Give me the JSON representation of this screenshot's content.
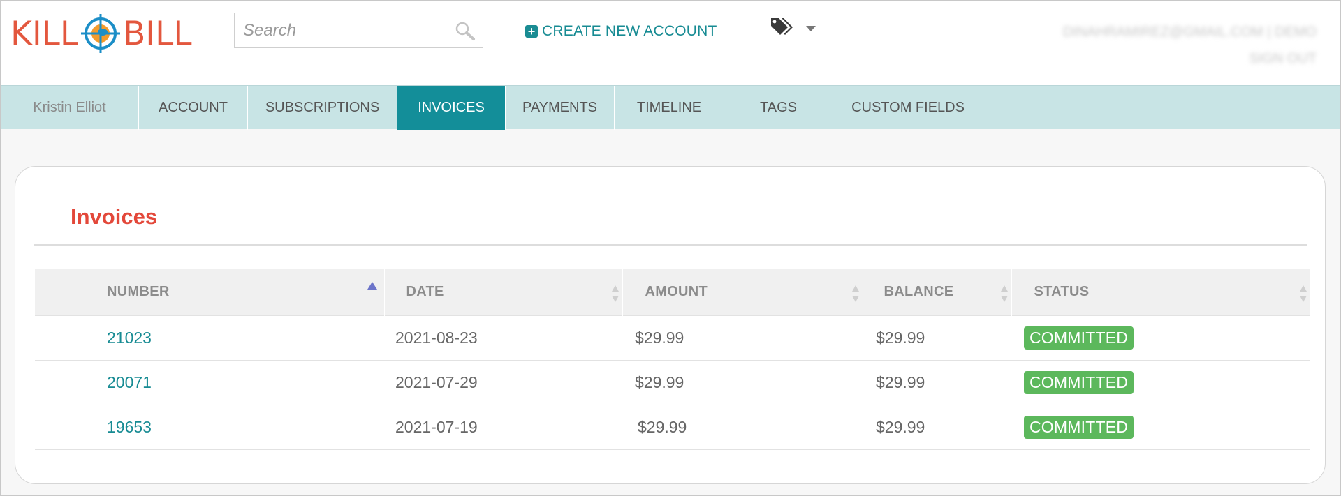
{
  "header": {
    "logo": {
      "left": "KILL",
      "right": "BILL"
    },
    "search": {
      "placeholder": "Search"
    },
    "create_account_label": "CREATE NEW ACCOUNT",
    "user_line1": "DINAHRAMIREZ@GMAIL.COM | DEMO",
    "user_line2": "SIGN OUT"
  },
  "nav": {
    "customer": "Kristin Elliot",
    "tabs": [
      {
        "label": "ACCOUNT"
      },
      {
        "label": "SUBSCRIPTIONS"
      },
      {
        "label": "INVOICES"
      },
      {
        "label": "PAYMENTS"
      },
      {
        "label": "TIMELINE"
      },
      {
        "label": "TAGS"
      },
      {
        "label": "CUSTOM FIELDS"
      }
    ]
  },
  "panel": {
    "title": "Invoices",
    "columns": [
      "NUMBER",
      "DATE",
      "AMOUNT",
      "BALANCE",
      "STATUS"
    ],
    "rows": [
      {
        "number": "21023",
        "date": "2021-08-23",
        "amount": "$29.99",
        "balance": "$29.99",
        "status": "COMMITTED"
      },
      {
        "number": "20071",
        "date": "2021-07-29",
        "amount": "$29.99",
        "balance": "$29.99",
        "status": "COMMITTED"
      },
      {
        "number": "19653",
        "date": "2021-07-19",
        "amount": "$29.99",
        "balance": "$29.99",
        "status": "COMMITTED"
      }
    ]
  },
  "colors": {
    "accent": "#138e99",
    "nav_bg": "#c8e4e5",
    "title_red": "#e3483a",
    "status_green": "#5cb85c"
  },
  "icons": {
    "search": "search-icon",
    "plus": "plus-square-icon",
    "tags": "tags-icon",
    "caret": "caret-down-icon"
  }
}
